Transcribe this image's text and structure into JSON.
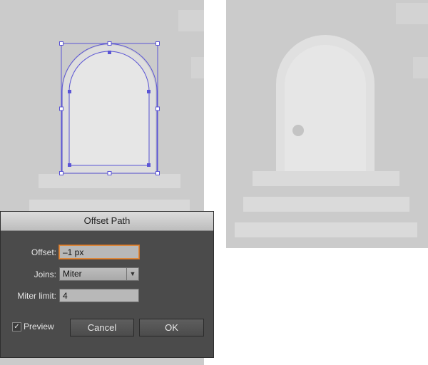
{
  "dialog": {
    "title": "Offset Path",
    "offset": {
      "label": "Offset:",
      "value": "–1 px"
    },
    "joins": {
      "label": "Joins:",
      "value": "Miter"
    },
    "miter_limit": {
      "label": "Miter limit:",
      "value": "4"
    },
    "preview": {
      "label": "Preview",
      "checked": true
    },
    "cancel_label": "Cancel",
    "ok_label": "OK"
  },
  "icons": {
    "preview_checkbox": "checkmark-icon",
    "joins_dropdown": "triangle-down-icon"
  },
  "colors": {
    "canvas": "#cbcbcb",
    "door_light": "#e6e6e6",
    "door_arch": "#e0e0e0",
    "steps": "#dadada",
    "selection": "#5b55d6",
    "knob": "#c4c4c4",
    "dialog_bg": "#4b4b4b",
    "focus": "#e08a3c"
  }
}
